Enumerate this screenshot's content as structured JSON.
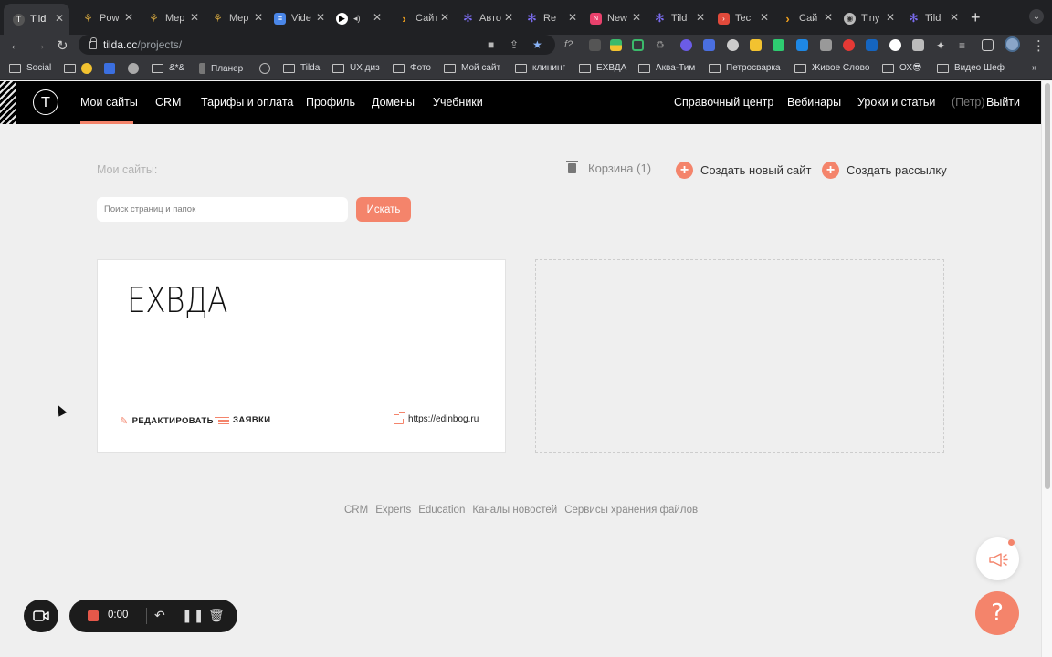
{
  "browser": {
    "tabs": [
      {
        "title": "Tild",
        "icon": "tilda-icon",
        "color": "#444"
      },
      {
        "title": "Pow",
        "icon": "merge-icon",
        "color": "#c49a3c"
      },
      {
        "title": "Mep",
        "icon": "merge-icon",
        "color": "#c49a3c"
      },
      {
        "title": "Mep",
        "icon": "merge-icon",
        "color": "#c49a3c"
      },
      {
        "title": "Vide",
        "icon": "docs-icon",
        "color": "#4a86e8"
      },
      {
        "title": "",
        "icon": "play-icon",
        "color": "#ffffff"
      },
      {
        "title": "Сайт",
        "icon": "chevron-icon",
        "color": "#f0a01d"
      },
      {
        "title": "Авто",
        "icon": "flower-icon",
        "color": "#6b5ce7"
      },
      {
        "title": "Re",
        "icon": "flower-icon",
        "color": "#6b5ce7"
      },
      {
        "title": "New",
        "icon": "brand-icon",
        "color": "#e8416c"
      },
      {
        "title": "Tild",
        "icon": "flower-icon",
        "color": "#6b5ce7"
      },
      {
        "title": "Tec",
        "icon": "brand-icon",
        "color": "#e24a3b"
      },
      {
        "title": "Сай",
        "icon": "chevron-icon",
        "color": "#f0a01d"
      },
      {
        "title": "Tiny",
        "icon": "globe-icon",
        "color": "#bbbbbb"
      },
      {
        "title": "Tild",
        "icon": "flower-icon",
        "color": "#6b5ce7"
      }
    ],
    "url_host": "tilda.cc",
    "url_path": "/projects/",
    "bookmarks": [
      "Social",
      "",
      "",
      "",
      "&*&",
      "Планер",
      "",
      "Tilda",
      "UX диз",
      "Фото",
      "Мой сайт",
      "клининг",
      "ЕХВДА",
      "Аква-Тим",
      "Петросварка",
      "Живое Слово",
      "ОХ😎",
      "Видео Шеф"
    ]
  },
  "nav": {
    "logo": "T",
    "left": [
      "Мои сайты",
      "CRM",
      "Тарифы и оплата",
      "Профиль",
      "Домены",
      "Учебники"
    ],
    "right": [
      "Справочный центр",
      "Вебинары",
      "Уроки и статьи"
    ],
    "user": "(Петр)",
    "logout": "Выйти"
  },
  "page": {
    "label": "Мои сайты:",
    "trash": "Корзина (1)",
    "create_site": "Создать новый сайт",
    "create_mailing": "Создать рассылку",
    "search_placeholder": "Поиск страниц и папок",
    "search_button": "Искать"
  },
  "site": {
    "title": "ЕХВДА",
    "edit": "РЕДАКТИРОВАТЬ",
    "leads": "ЗАЯВКИ",
    "url": "https://edinbog.ru"
  },
  "footer": [
    "CRM",
    "Experts",
    "Education",
    "Каналы новостей",
    "Сервисы хранения файлов"
  ],
  "recorder": {
    "time": "0:00"
  },
  "colors": {
    "accent": "#f4846b",
    "nav_bg": "#000000",
    "page_bg": "#efefef"
  }
}
